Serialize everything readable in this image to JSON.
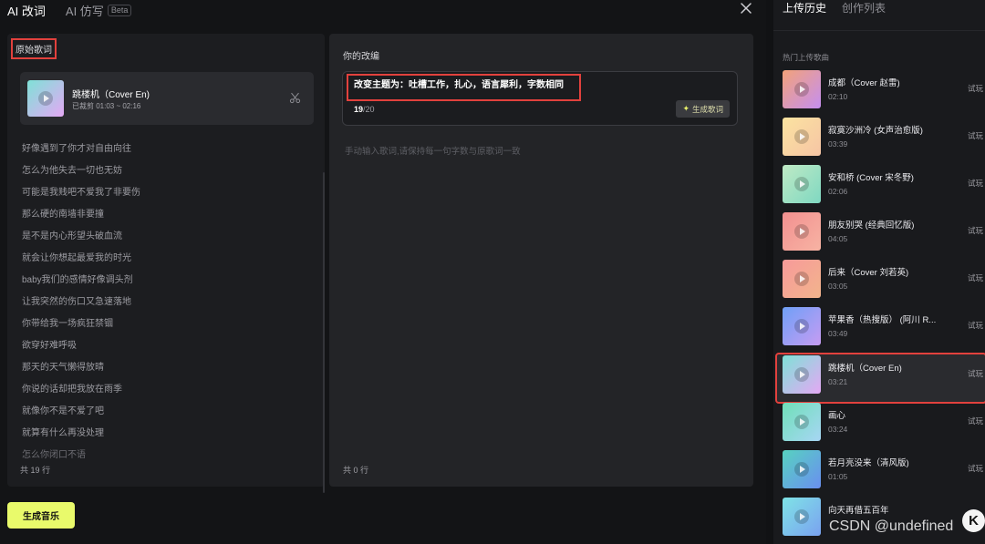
{
  "tabs": [
    {
      "label": "AI 改词",
      "active": true
    },
    {
      "label": "AI 仿写",
      "badge": "Beta",
      "active": false
    }
  ],
  "original": {
    "title": "原始歌词",
    "song": {
      "title": "跳楼机（Cover En)",
      "clip": "已裁剪 01:03 ~ 02:16"
    },
    "lyrics": [
      "好像遇到了你才对自由向往",
      "怎么为他失去一切也无妨",
      "可能是我贱吧不爱我了非要伤",
      "那么硬的南墙非要撞",
      "是不是内心形望头破血流",
      "就会让你想起最爱我的时光",
      "baby我们的感情好像调头剂",
      "让我突然的伤口又急速落地",
      "你带给我一场疯狂禁锢",
      "欲穿好难呼吸",
      "那天的天气懒得放晴",
      "你说的话却把我放在雨季",
      "就像你不是不爱了吧",
      "就算有什么再没处理",
      "怎么你闭口不语"
    ],
    "count": "共 19 行"
  },
  "rewrite": {
    "title": "你的改编",
    "prompt": "改变主题为：吐槽工作，扎心，语言犀利，字数相同",
    "counter_current": "19",
    "counter_max": "/20",
    "generate_label": "生成歌词",
    "generate_icon": "sparkle-icon",
    "placeholder": "手动输入歌词,请保持每一句字数与原歌词一致",
    "count": "共 0 行"
  },
  "generate_music_label": "生成音乐",
  "sidebar": {
    "tabs": [
      {
        "label": "上传历史",
        "active": true
      },
      {
        "label": "创作列表",
        "active": false
      }
    ],
    "section_title": "热门上传歌曲",
    "try_label": "试玩",
    "songs": [
      {
        "title": "成都（Cover 赵雷)",
        "duration": "02:10",
        "colors": [
          "#f2a27a",
          "#c58ff0"
        ]
      },
      {
        "title": "寂寞沙洲冷 (女声治愈版)",
        "duration": "03:39",
        "colors": [
          "#fbe3a0",
          "#f6c5a5"
        ]
      },
      {
        "title": "安和桥 (Cover 宋冬野)",
        "duration": "02:06",
        "colors": [
          "#bfeac4",
          "#7fd8c2"
        ]
      },
      {
        "title": "朋友别哭 (经典回忆版)",
        "duration": "04:05",
        "colors": [
          "#f29090",
          "#f7b3a3"
        ]
      },
      {
        "title": "后来（Cover 刘若英)",
        "duration": "03:05",
        "colors": [
          "#f79a9a",
          "#f2b48c"
        ]
      },
      {
        "title": "苹果香（热搜版） (阿川 R...",
        "duration": "03:49",
        "colors": [
          "#6fa0f7",
          "#c69cf2"
        ]
      },
      {
        "title": "跳楼机（Cover En)",
        "duration": "03:21",
        "colors": [
          "#7fe1d7",
          "#e4a8f4"
        ],
        "selected": true
      },
      {
        "title": "画心",
        "duration": "03:24",
        "colors": [
          "#6fe0b8",
          "#a7d6f4"
        ]
      },
      {
        "title": "若月亮没来（清风版)",
        "duration": "01:05",
        "colors": [
          "#57d2c0",
          "#6a8ff0"
        ]
      },
      {
        "title": "向天再借五百年",
        "duration": "",
        "colors": [
          "#7fe3e6",
          "#7aa2f0"
        ]
      }
    ]
  },
  "watermark": "CSDN @undefined",
  "logo_letter": "K"
}
